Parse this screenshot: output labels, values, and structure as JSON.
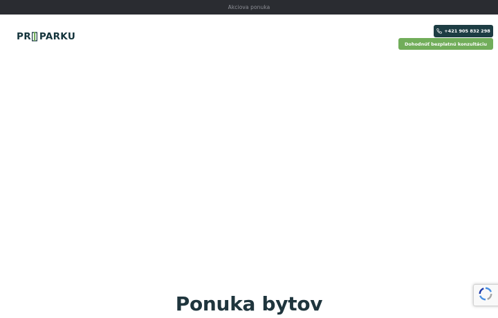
{
  "topbar": {
    "link_text": "Akciova ponuka"
  },
  "logo": {
    "part1": "PR",
    "part2": "PARKU",
    "text": "PRI PARKU"
  },
  "header": {
    "phone_label": "+421 905 832 298",
    "consult_label": "Dohodnúť bezplatnú konzultáciu"
  },
  "main": {
    "headline": "Ponuka bytov"
  },
  "colors": {
    "topbar_bg": "#2a2c31",
    "brand_dark": "#1d3d43",
    "accent_green": "#71ad5a",
    "heading": "#1f353d"
  },
  "icons": {
    "phone": "phone-icon",
    "logo_mark": "logo-mark-icon",
    "recaptcha": "recaptcha-icon"
  }
}
